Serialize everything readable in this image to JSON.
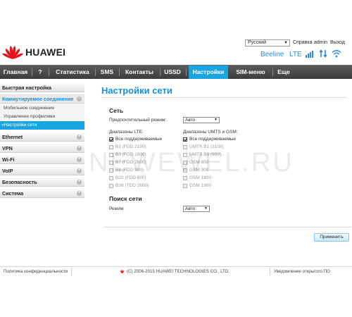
{
  "top": {
    "language": "Русский",
    "help": "Справка",
    "user": "admin",
    "logout": "Выход"
  },
  "brand": {
    "name": "HUAWEI",
    "color": "#e0161c"
  },
  "status": {
    "operator": "Beeline",
    "network": "LTE",
    "accent": "#2a8bd6"
  },
  "nav": [
    "Главная",
    "?",
    "Статистика",
    "SMS",
    "Контакты",
    "USSD",
    "Настройки",
    "SIM-меню",
    "Еще"
  ],
  "sidebar": {
    "quick": "Быстрая настройка",
    "dialup": "Коммутируемое соединение",
    "dialup_sub": [
      "Мобильное соединение",
      "Управление профилями",
      "»Настройки сети"
    ],
    "others": [
      "Ethernet",
      "VPN",
      "Wi-Fi",
      "VoIP",
      "Безопасность",
      "Система"
    ]
  },
  "main": {
    "title": "Настройки сети",
    "network": {
      "heading": "Сеть",
      "preferred_label": "Предпочтительный режим:",
      "preferred_value": "Авто",
      "lte_label": "Диапазоны LTE:",
      "lte_bands": [
        "Все поддерживаемые",
        "B1 (FDD 2100)",
        "B3 (FDD 1800)",
        "B7 (FDD 2600)",
        "B8 (FDD 900)",
        "B20 (FDD 800)",
        "B38 (TDD 2600)"
      ],
      "umts_label": "Диапазоны UMTS и GSM:",
      "umts_bands": [
        "Все поддерживаемые",
        "UMTS B1 (2100)",
        "UMTS B8 (900)",
        "GSM 850",
        "GSM 900",
        "GSM 1800",
        "GSM 1900"
      ]
    },
    "search": {
      "heading": "Поиск сети",
      "mode_label": "Режим:",
      "mode_value": "Авто"
    },
    "apply": "Применить"
  },
  "watermark": "NEWEWEL.RU",
  "footer": {
    "privacy": "Политика конфиденциальности",
    "copyright": "(C) 2006-2015 HUAWEI TECHNOLOGIES CO., LTD.",
    "opensource": "Уведомление открытого ПО"
  }
}
